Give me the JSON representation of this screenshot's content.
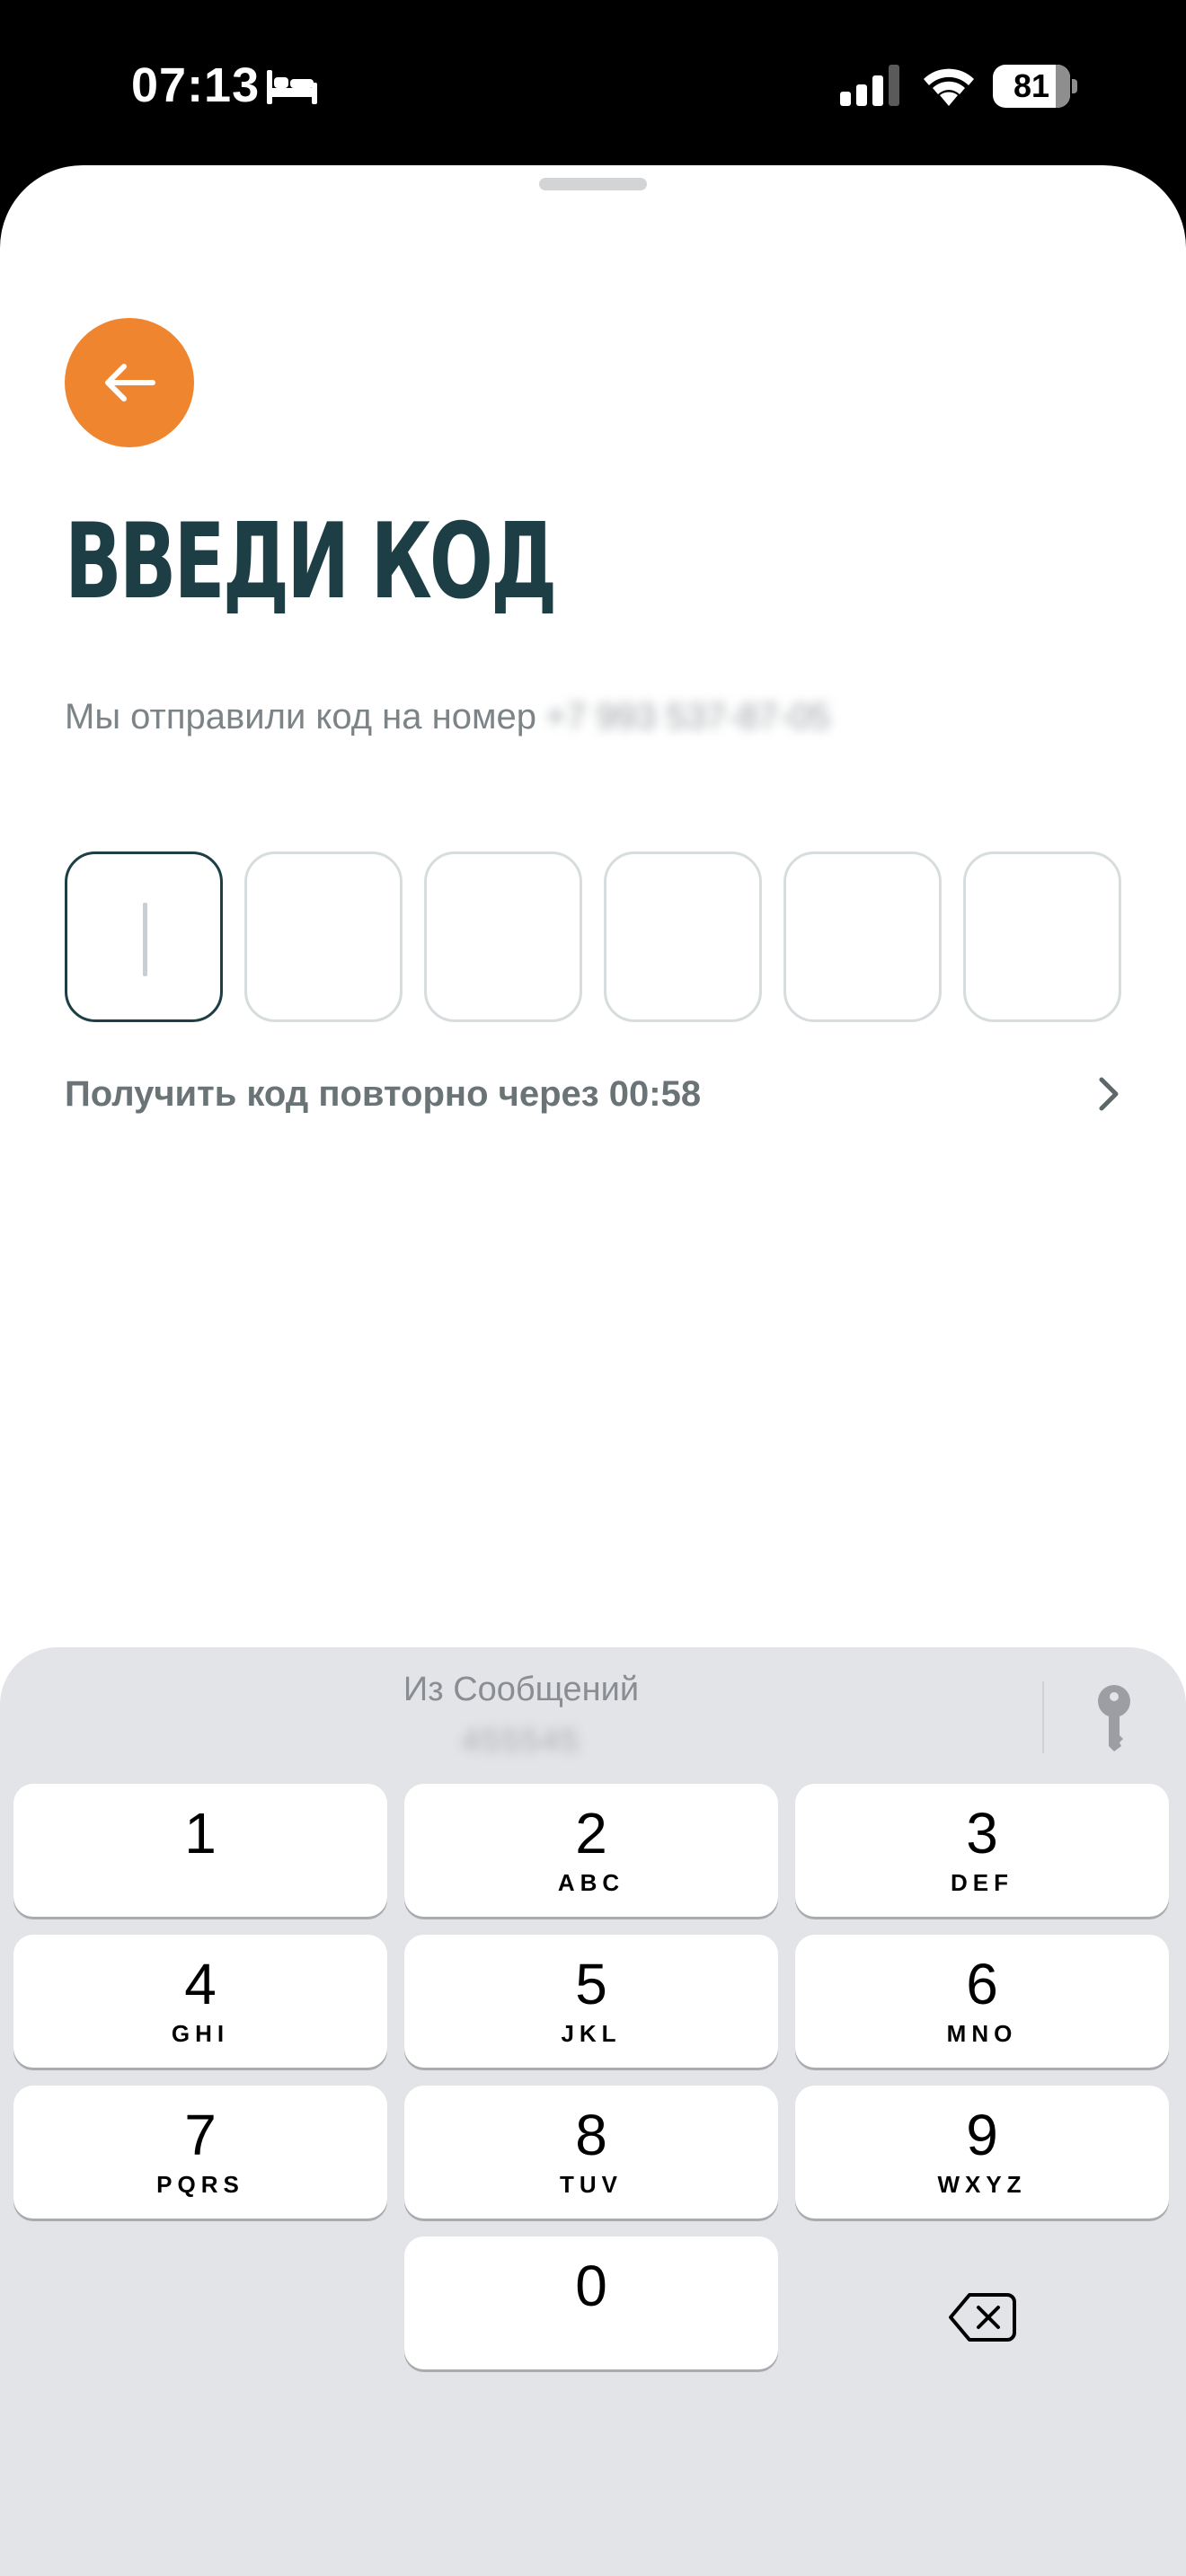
{
  "status_bar": {
    "time": "07:13",
    "battery": "81",
    "battery_level_percent": 81,
    "icons": [
      "bed-icon",
      "signal-icon",
      "wifi-icon",
      "battery-icon"
    ]
  },
  "screen": {
    "title": "ВВЕДИ КОД",
    "subtitle": "Мы отправили код на номер",
    "phone": "+7 993 537-87-05",
    "code_length": 6,
    "code_cells": [
      "",
      "",
      "",
      "",
      "",
      ""
    ],
    "resend_text": "Получить код повторно через 00:58",
    "icons": [
      "back-arrow-icon",
      "chevron-right-icon"
    ],
    "colors": {
      "accent": "#f08530",
      "title": "#1d3e45",
      "cell_border": "#d7dcde"
    }
  },
  "keyboard": {
    "suggestion_title": "Из Сообщений",
    "suggestion_code": "455545",
    "keys": [
      {
        "digit": "1",
        "letters": ""
      },
      {
        "digit": "2",
        "letters": "ABC"
      },
      {
        "digit": "3",
        "letters": "DEF"
      },
      {
        "digit": "4",
        "letters": "GHI"
      },
      {
        "digit": "5",
        "letters": "JKL"
      },
      {
        "digit": "6",
        "letters": "MNO"
      },
      {
        "digit": "7",
        "letters": "PQRS"
      },
      {
        "digit": "8",
        "letters": "TUV"
      },
      {
        "digit": "9",
        "letters": "WXYZ"
      },
      {
        "digit": "0",
        "letters": ""
      }
    ],
    "icons": [
      "key-icon",
      "backspace-icon"
    ]
  }
}
